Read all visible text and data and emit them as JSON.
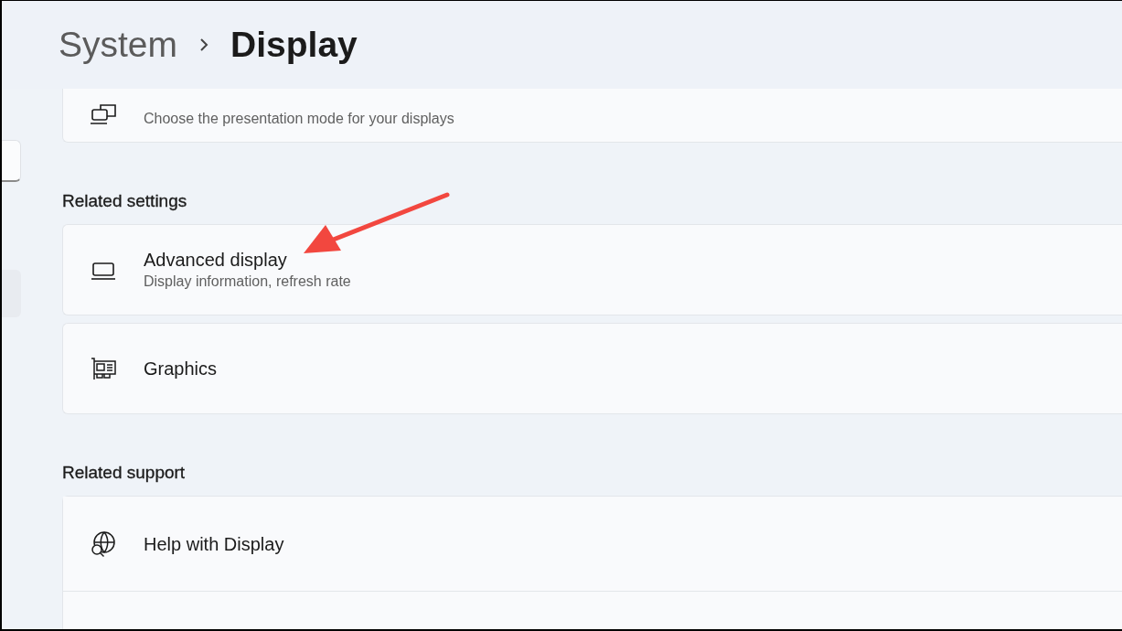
{
  "header": {
    "breadcrumb": [
      {
        "label": "System",
        "selected": false
      },
      {
        "label": "Display",
        "selected": true
      }
    ]
  },
  "sections": [
    {
      "items": [
        {
          "kind": "monitors",
          "subtitle": "Choose the presentation mode for your displays"
        }
      ]
    },
    {
      "heading": "Related settings",
      "items": [
        {
          "kind": "laptop",
          "title": "Advanced display",
          "subtitle": "Display information, refresh rate"
        },
        {
          "kind": "graphics-card",
          "title": "Graphics"
        }
      ]
    },
    {
      "heading": "Related support",
      "items": [
        {
          "kind": "globe",
          "title": "Help with Display"
        }
      ]
    }
  ]
}
